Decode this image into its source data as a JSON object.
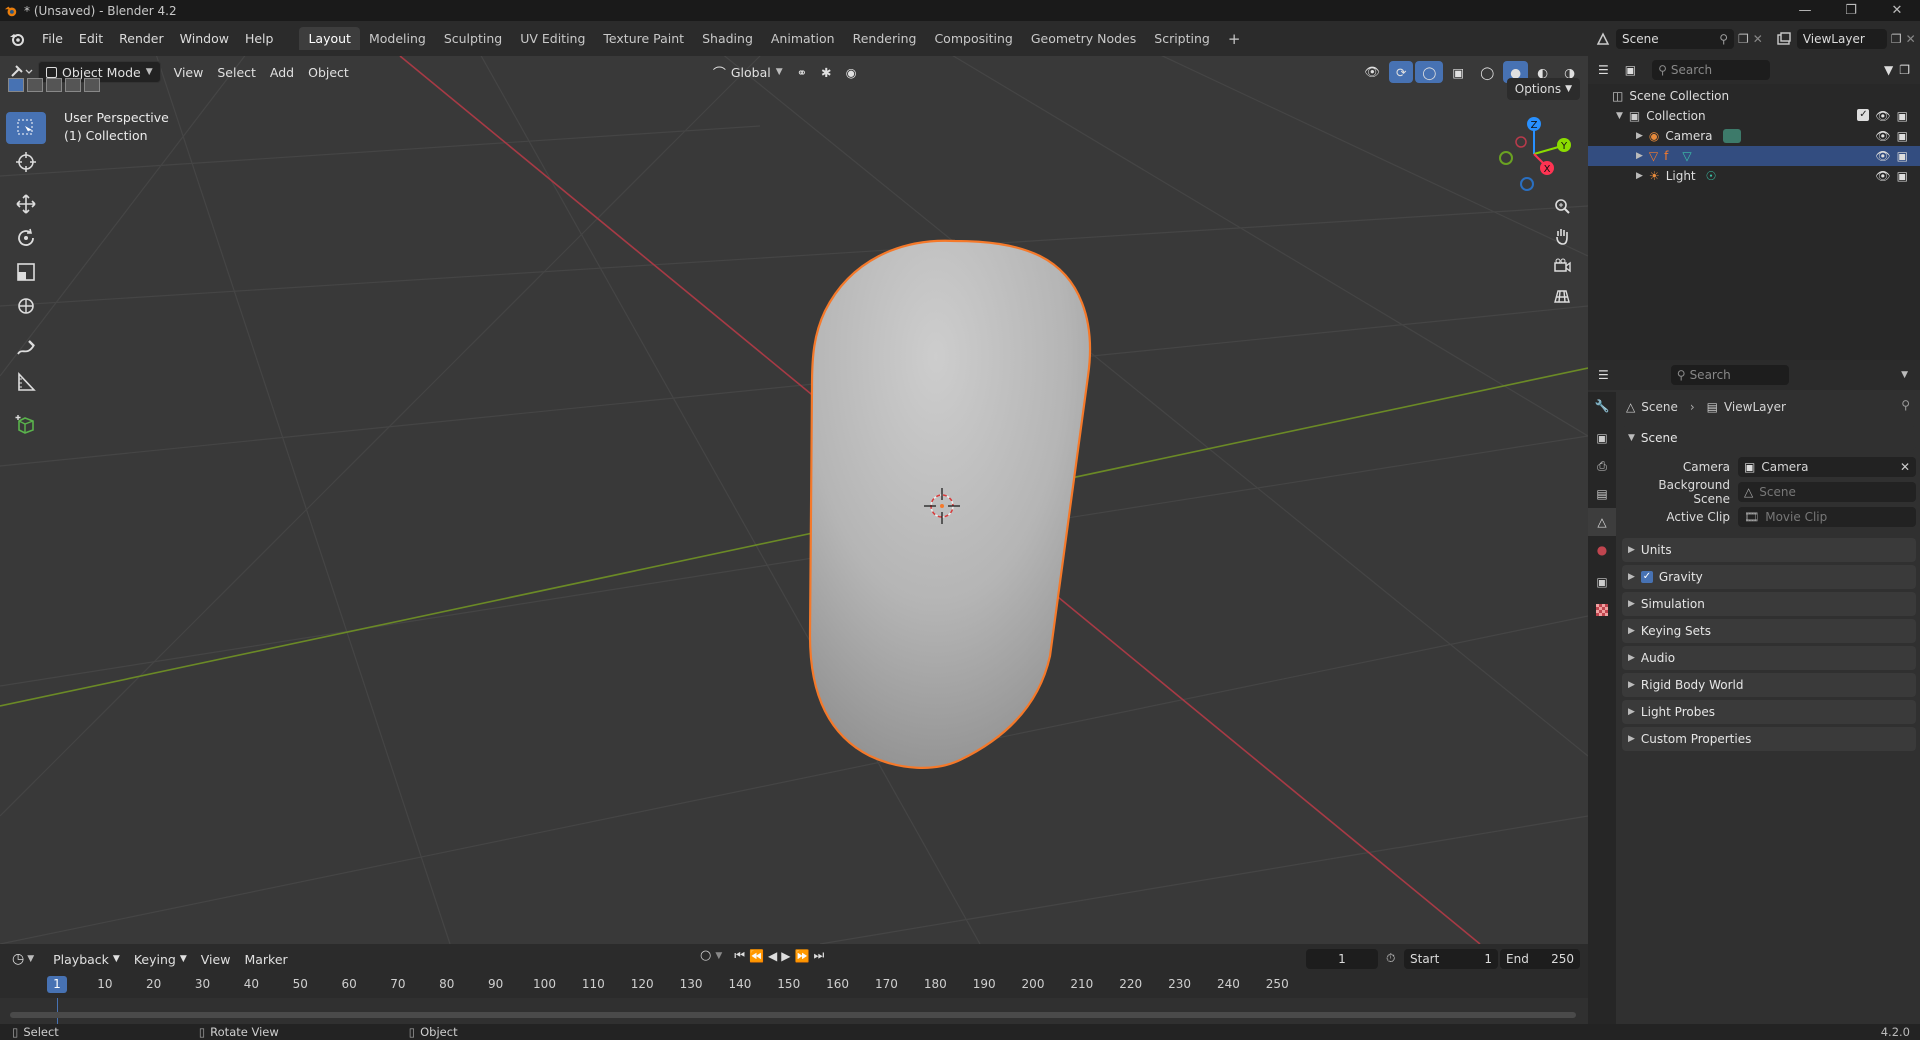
{
  "window": {
    "title": "* (Unsaved) - Blender 4.2"
  },
  "menu": [
    "File",
    "Edit",
    "Render",
    "Window",
    "Help"
  ],
  "workspaces": [
    "Layout",
    "Modeling",
    "Sculpting",
    "UV Editing",
    "Texture Paint",
    "Shading",
    "Animation",
    "Rendering",
    "Compositing",
    "Geometry Nodes",
    "Scripting"
  ],
  "scene_selector": {
    "scene": "Scene",
    "view_layer": "ViewLayer"
  },
  "viewport": {
    "mode": "Object Mode",
    "menus": [
      "View",
      "Select",
      "Add",
      "Object"
    ],
    "transform_orientation": "Global",
    "options_label": "Options",
    "info_line1": "User Perspective",
    "info_line2": "(1) Collection",
    "gizmo_axes": {
      "z": "Z",
      "y": "Y",
      "x": "X"
    }
  },
  "outliner": {
    "search_placeholder": "Search",
    "root": "Scene Collection",
    "collection": "Collection",
    "items": [
      {
        "name": "Camera",
        "type": "camera"
      },
      {
        "name": "f",
        "type": "mesh"
      },
      {
        "name": "Light",
        "type": "light"
      }
    ]
  },
  "properties": {
    "search_placeholder": "Search",
    "breadcrumb": [
      "Scene",
      "ViewLayer"
    ],
    "scene_panel": "Scene",
    "fields": [
      {
        "label": "Camera",
        "value": "Camera",
        "placeholder": ""
      },
      {
        "label": "Background Scene",
        "value": "",
        "placeholder": "Scene"
      },
      {
        "label": "Active Clip",
        "value": "",
        "placeholder": "Movie Clip"
      }
    ],
    "panels": [
      "Units",
      "Gravity",
      "Simulation",
      "Keying Sets",
      "Audio",
      "Rigid Body World",
      "Light Probes",
      "Custom Properties"
    ]
  },
  "timeline": {
    "menus": [
      "Playback",
      "Keying",
      "View",
      "Marker"
    ],
    "current_frame": "1",
    "start_label": "Start",
    "start": "1",
    "end_label": "End",
    "end": "250",
    "ticks": [
      "10",
      "20",
      "30",
      "40",
      "50",
      "60",
      "70",
      "80",
      "90",
      "100",
      "110",
      "120",
      "130",
      "140",
      "150",
      "160",
      "170",
      "180",
      "190",
      "200",
      "210",
      "220",
      "230",
      "240",
      "250"
    ]
  },
  "statusbar": {
    "select": "Select",
    "rotate": "Rotate View",
    "object": "Object",
    "version": "4.2.0"
  },
  "colors": {
    "accent": "#4772b3",
    "selection_outline": "#f5792a",
    "x_axis": "#ff3352",
    "y_axis": "#8bdc00",
    "z_axis": "#2890ff"
  }
}
